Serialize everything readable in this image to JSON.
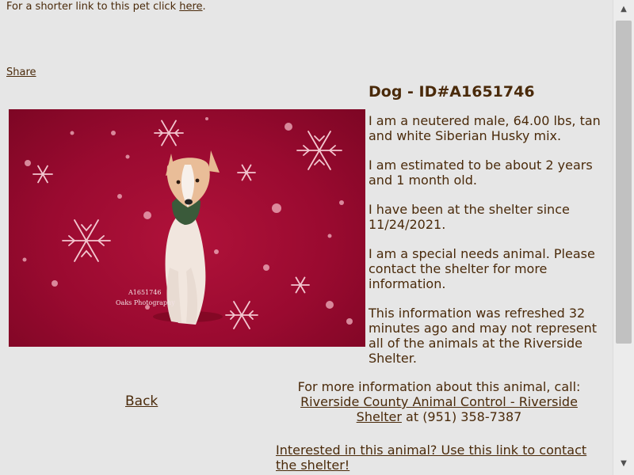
{
  "header": {
    "shorter_link_prefix": "For a shorter link to this pet click ",
    "shorter_link_text": "here",
    "shorter_link_suffix": ".",
    "share_label": "Share"
  },
  "photo": {
    "watermark_id": "A1651746",
    "watermark_credit": "Oaks Photography"
  },
  "pet": {
    "title": "Dog - ID#A1651746",
    "description": "I am a neutered male, 64.00 lbs, tan and white Siberian Husky mix.",
    "age": "I am estimated to be about 2 years and 1 month old.",
    "since": "I have been at the shelter since 11/24/2021.",
    "special": "I am a special needs animal. Please contact the shelter for more information.",
    "refreshed": "This information was refreshed 32 minutes ago and may not represent all of the animals at the Riverside Shelter."
  },
  "nav": {
    "back_label": "Back"
  },
  "contact": {
    "more_info": "For more information about this animal, call:",
    "shelter_name": "Riverside County Animal Control - Riverside Shelter",
    "phone_prefix": " at ",
    "phone": "(951) 358-7387",
    "interested_link": "Interested in this animal? Use this link to contact the shelter!"
  },
  "colors": {
    "page_bg": "#e6e6e6",
    "text": "#4a2a0a",
    "photo_bg": "#9a0a30"
  }
}
